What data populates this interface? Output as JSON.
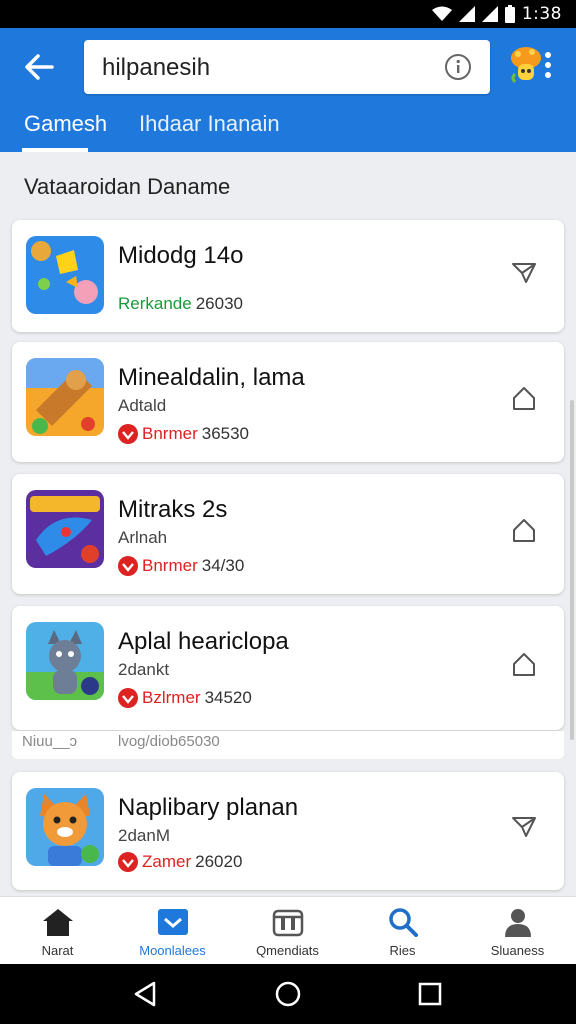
{
  "status_bar": {
    "time": "1:38"
  },
  "search": {
    "query": "hilpanesih"
  },
  "tabs": [
    {
      "label": "Gamesh"
    },
    {
      "label": "Ihdaar Inanain"
    }
  ],
  "section_title": "Vataaroidan Daname",
  "apps": [
    {
      "title": "Midodg 14o",
      "subtitle": "",
      "tag": "Rerkande",
      "count": "26030",
      "tag_color": "#1a9a3a",
      "action_icon": "send-outline-icon"
    },
    {
      "title": "Minealdalin, lama",
      "subtitle": "Adtald",
      "tag": "Bnrmer",
      "count": "36530",
      "tag_color": "#d22222",
      "action_icon": "home-icon"
    },
    {
      "title": "Mitraks 2s",
      "subtitle": "Arlnah",
      "tag": "Bnrmer",
      "count": "34/30",
      "tag_color": "#d22222",
      "action_icon": "home-icon"
    },
    {
      "title": "Aplal heariclopa",
      "subtitle": "2dankt",
      "tag": "Bzlrmer",
      "count": "34520",
      "tag_color": "#d22222",
      "action_icon": "home-icon"
    },
    {
      "title": "Naplibary planan",
      "subtitle": "2danM",
      "tag": "Zamer",
      "count": "26020",
      "tag_color": "#d22222",
      "action_icon": "send-outline-icon"
    }
  ],
  "peek_row": {
    "left": "Niuu__ɔ",
    "text": "lvog/diob65030"
  },
  "bottom_nav": [
    {
      "label": "Narat",
      "icon": "home-icon"
    },
    {
      "label": "Moonlalees",
      "icon": "message-icon",
      "active": true
    },
    {
      "label": "Qmendiats",
      "icon": "store-icon"
    },
    {
      "label": "Ries",
      "icon": "search-icon"
    },
    {
      "label": "Sluaness",
      "icon": "person-icon"
    }
  ],
  "colors": {
    "primary": "#1f78dc",
    "accent_red": "#d22222",
    "accent_green": "#1a9a3a"
  }
}
